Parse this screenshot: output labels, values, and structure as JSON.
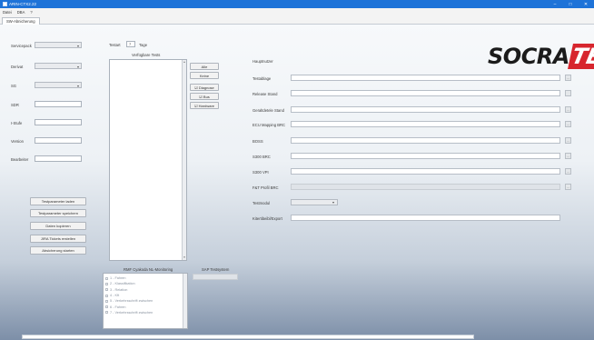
{
  "window": {
    "title": "ARIN-CTX2.22",
    "controls": [
      "–",
      "□",
      "✕"
    ]
  },
  "menu": [
    "Datei",
    "DBA",
    "?"
  ],
  "tab": "SW-Abnicherung",
  "left_panel": {
    "fields": [
      {
        "label": "Servicepack",
        "type": "combo",
        "value": ""
      },
      {
        "label": "Derivat",
        "type": "combo",
        "value": ""
      },
      {
        "label": "SG",
        "type": "combo",
        "value": ""
      },
      {
        "label": "SDR",
        "type": "input",
        "value": ""
      },
      {
        "label": "I-Stufe",
        "type": "input",
        "value": ""
      },
      {
        "label": "Version",
        "type": "input",
        "value": ""
      },
      {
        "label": "Bearbeiter",
        "type": "input",
        "value": ""
      }
    ],
    "buttons": [
      "Testparameter laden",
      "Testparameter speichern",
      "Daten kopieren",
      "JIRA Tickets erstellen",
      "Absicherung starten"
    ]
  },
  "middle_panel": {
    "testart_label": "Testart",
    "testart_value": "7",
    "tage_label": "Tage",
    "available_tests_label": "Verfügbare Tests",
    "test_buttons": [
      "Alle",
      "Keine",
      "☑ Diagnose",
      "☑ Bus",
      "☑ Hardware"
    ],
    "rmf_label": "RMF Cyakoda NL-Monitoring",
    "rmf_items": [
      "1 - Fahren",
      "2 - Klassifikation",
      "3 - Relation",
      "4 - Kft",
      "5 - Verkehrsschrift zwischen",
      "6 - Fahren",
      "7 - Verkehrsschrift zwischen"
    ],
    "sap_label": "SAP Testsystem",
    "sap_value": ""
  },
  "right_panel": {
    "header": "Hauptnutzer",
    "rows": [
      {
        "label": "Testablage",
        "value": "",
        "button": "...",
        "disabled": false
      },
      {
        "label": "Release Stand",
        "value": "",
        "button": "",
        "disabled": false
      },
      {
        "label": "Geraltdetele Stand",
        "value": "",
        "button": "...",
        "disabled": false
      },
      {
        "label": "ECU Mapping BRC",
        "value": "",
        "button": "...",
        "disabled": false
      },
      {
        "label": "BOSS",
        "value": "",
        "button": "...",
        "disabled": false
      },
      {
        "label": "S300 BRC",
        "value": "",
        "button": "...",
        "disabled": false
      },
      {
        "label": "S300 VPI",
        "value": "",
        "button": "...",
        "disabled": false
      },
      {
        "label": "F&T Profil BRC",
        "value": "",
        "button": "...",
        "disabled": true
      }
    ],
    "testmodul_label": "Testmodul",
    "testmodul_value": "",
    "kommentar_label": "Kitertibeibl/Export",
    "kommentar_value": ""
  },
  "logo": {
    "text_main": "SOCRA",
    "text_accent": "TEL"
  },
  "colors": {
    "titlebar": "#1e73d8",
    "logo_accent": "#d7262e"
  }
}
